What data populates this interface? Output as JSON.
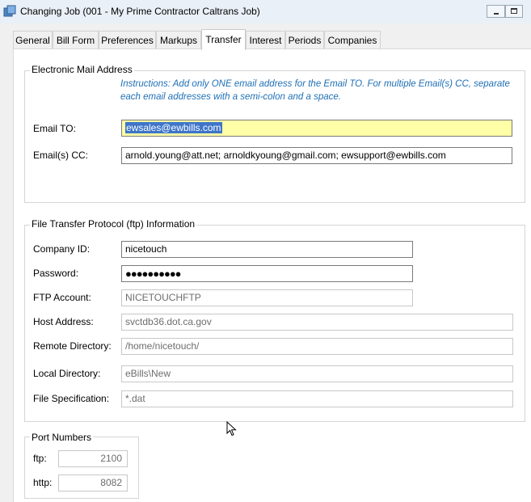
{
  "window": {
    "title": "Changing Job  (001 - My Prime Contractor Caltrans Job)"
  },
  "tabs": [
    {
      "label": "General"
    },
    {
      "label": "Bill Form"
    },
    {
      "label": "Preferences"
    },
    {
      "label": "Markups"
    },
    {
      "label": "Transfer"
    },
    {
      "label": "Interest"
    },
    {
      "label": "Periods"
    },
    {
      "label": "Companies"
    }
  ],
  "active_tab": "Transfer",
  "email": {
    "legend": "Electronic Mail Address",
    "instructions_line1": "Instructions: Add only ONE email address for the Email TO. For multiple Email(s) CC, separate",
    "instructions_line2": "each email addresses with a semi-colon and a space.",
    "to_label": "Email TO:",
    "to_value": "ewsales@ewbills.com",
    "cc_label": "Email(s) CC:",
    "cc_value": "arnold.young@att.net; arnoldkyoung@gmail.com; ewsupport@ewbills.com"
  },
  "ftp": {
    "legend": "File Transfer Protocol (ftp) Information",
    "company_id_label": "Company ID:",
    "company_id_value": "nicetouch",
    "password_label": "Password:",
    "password_value": "●●●●●●●●●●",
    "ftp_account_label": "FTP Account:",
    "ftp_account_value": "NICETOUCHFTP",
    "host_label": "Host Address:",
    "host_value": "svctdb36.dot.ca.gov",
    "remote_dir_label": "Remote Directory:",
    "remote_dir_value": "/home/nicetouch/",
    "local_dir_label": "Local Directory:",
    "local_dir_value": "eBills\\New",
    "file_spec_label": "File Specification:",
    "file_spec_value": "*.dat"
  },
  "ports": {
    "legend": "Port Numbers",
    "ftp_label": "ftp:",
    "ftp_value": "2100",
    "http_label": "http:",
    "http_value": "8082"
  }
}
